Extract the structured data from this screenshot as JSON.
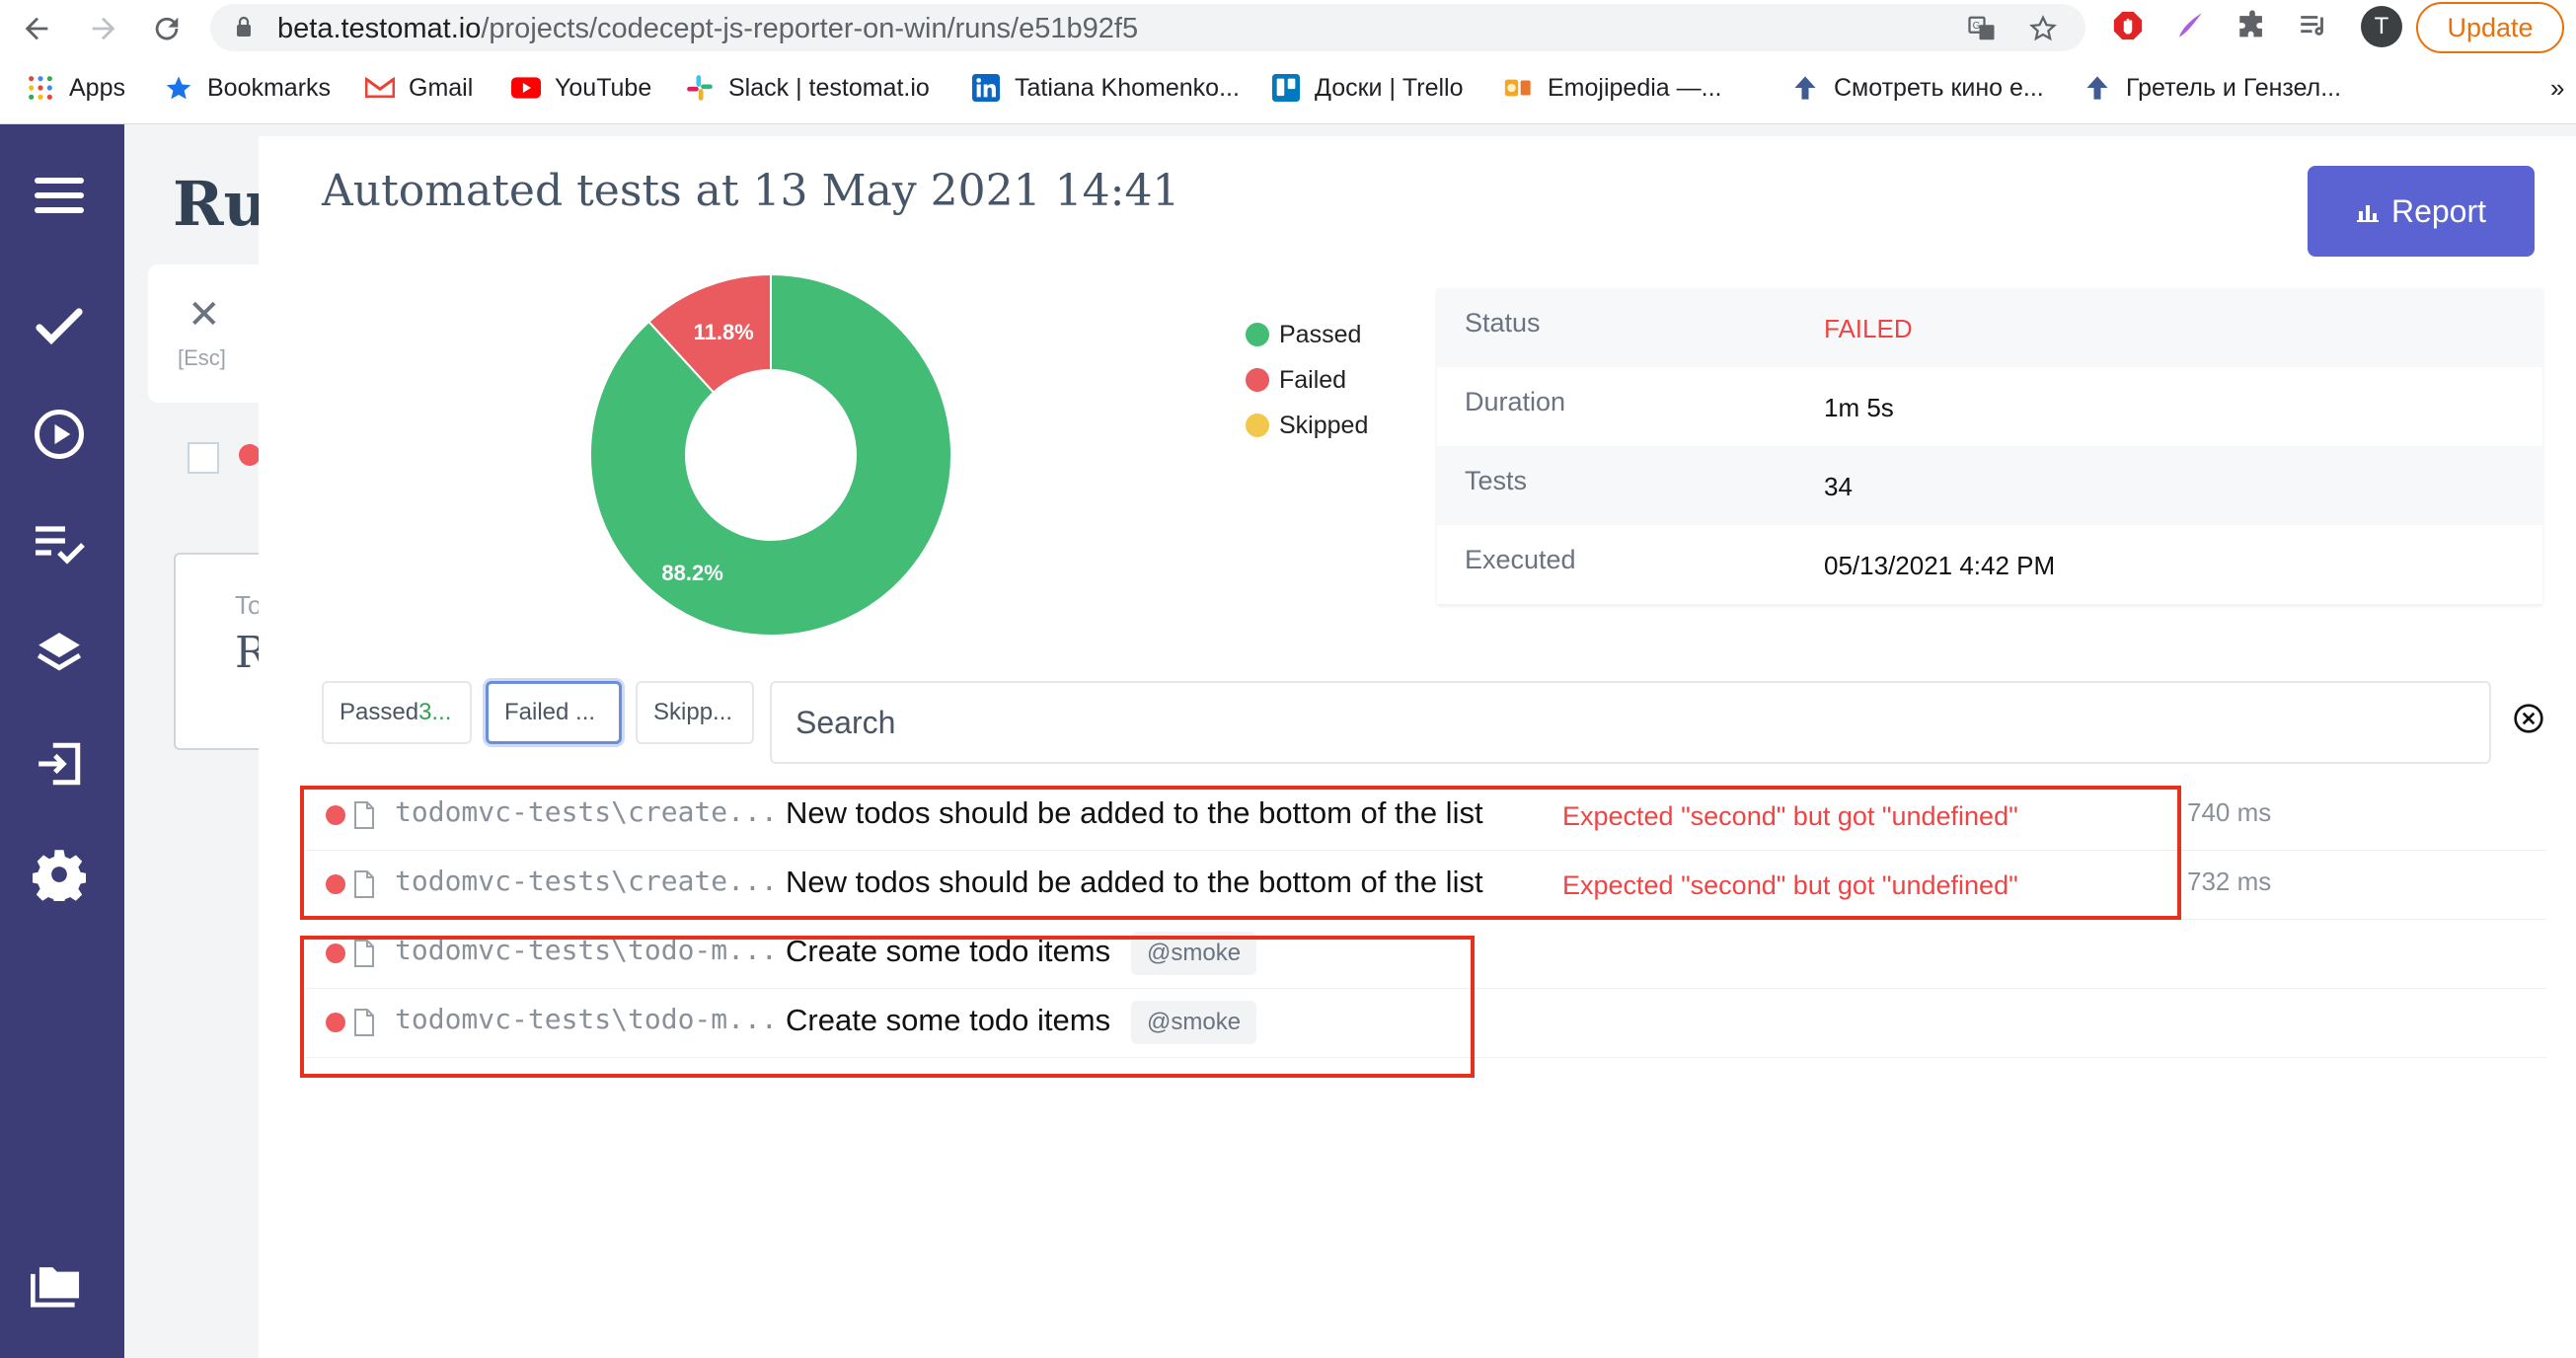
{
  "browser": {
    "url_host": "beta.testomat.io",
    "url_path": "/projects/codecept-js-reporter-on-win/runs/e51b92f5",
    "update_label": "Update",
    "profile_initial": "T"
  },
  "bookmarks": [
    {
      "label": "Apps",
      "icon": "apps-grid-icon"
    },
    {
      "label": "Bookmarks",
      "icon": "star-icon"
    },
    {
      "label": "Gmail",
      "icon": "gmail-icon"
    },
    {
      "label": "YouTube",
      "icon": "youtube-icon"
    },
    {
      "label": "Slack | testomat.io",
      "icon": "slack-icon"
    },
    {
      "label": "Tatiana Khomenko...",
      "icon": "linkedin-icon"
    },
    {
      "label": "Доски | Trello",
      "icon": "trello-icon"
    },
    {
      "label": "Emojipedia —...",
      "icon": "emojipedia-icon"
    },
    {
      "label": "Смотреть кино е...",
      "icon": "arrow-up-icon"
    },
    {
      "label": "Гретель и Гензел...",
      "icon": "arrow-up-icon"
    }
  ],
  "background": {
    "title": "Rur",
    "close_hint": "[Esc]",
    "card_text_1": "To",
    "card_text_2": "R"
  },
  "run": {
    "title": "Automated tests at 13 May 2021 14:41",
    "report_label": "Report"
  },
  "chart_data": {
    "type": "pie",
    "title": "",
    "series": [
      {
        "name": "Passed",
        "value": 88.2,
        "label": "88.2%",
        "color": "#43bc76"
      },
      {
        "name": "Failed",
        "value": 11.8,
        "label": "11.8%",
        "color": "#ea5b5f"
      },
      {
        "name": "Skipped",
        "value": 0,
        "label": "",
        "color": "#f1c84b"
      }
    ]
  },
  "legend": [
    {
      "label": "Passed",
      "color": "#43bc76"
    },
    {
      "label": "Failed",
      "color": "#ea5b5f"
    },
    {
      "label": "Skipped",
      "color": "#f1c84b"
    }
  ],
  "stats": [
    {
      "label": "Status",
      "value": "FAILED",
      "color": "#ef4444"
    },
    {
      "label": "Duration",
      "value": "1m 5s",
      "color": "#111111"
    },
    {
      "label": "Tests",
      "value": "34",
      "color": "#111111"
    },
    {
      "label": "Executed",
      "value": "05/13/2021 4:42 PM",
      "color": "#111111"
    }
  ],
  "filters": {
    "passed": "Passed ",
    "passed_count": "3...",
    "failed": "Failed ...",
    "skipped": "Skipp..."
  },
  "search": {
    "placeholder": "Search"
  },
  "tests": [
    {
      "path": "todomvc-tests\\create...",
      "name": "New todos should be added to the bottom of the list",
      "error": "Expected \"second\" but got \"undefined\"",
      "time": "740 ms",
      "tag": ""
    },
    {
      "path": "todomvc-tests\\create...",
      "name": "New todos should be added to the bottom of the list",
      "error": "Expected \"second\" but got \"undefined\"",
      "time": "732 ms",
      "tag": ""
    },
    {
      "path": "todomvc-tests\\todo-m...",
      "name": "Create some todo items",
      "error": "",
      "time": "",
      "tag": "@smoke"
    },
    {
      "path": "todomvc-tests\\todo-m...",
      "name": "Create some todo items",
      "error": "",
      "time": "",
      "tag": "@smoke"
    }
  ]
}
